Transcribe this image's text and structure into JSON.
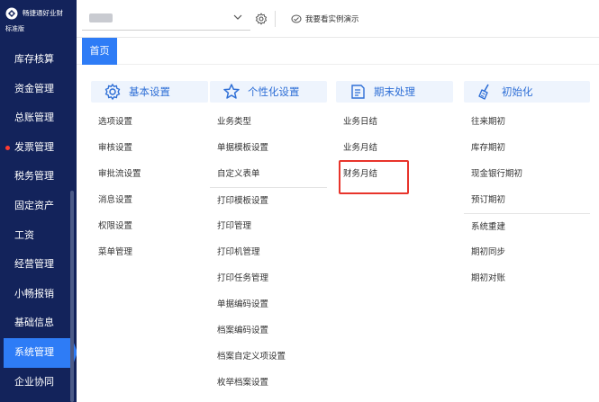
{
  "logo": {
    "brand": "畅捷通好业财",
    "edition": "标准版"
  },
  "sidebar": {
    "items": [
      {
        "label": "库存核算",
        "dot": false,
        "active": false
      },
      {
        "label": "资金管理",
        "dot": false,
        "active": false
      },
      {
        "label": "总账管理",
        "dot": false,
        "active": false
      },
      {
        "label": "发票管理",
        "dot": true,
        "active": false
      },
      {
        "label": "税务管理",
        "dot": false,
        "active": false
      },
      {
        "label": "固定资产",
        "dot": false,
        "active": false
      },
      {
        "label": "工资",
        "dot": false,
        "active": false
      },
      {
        "label": "经营管理",
        "dot": false,
        "active": false
      },
      {
        "label": "小畅报销",
        "dot": false,
        "active": false
      },
      {
        "label": "基础信息",
        "dot": false,
        "active": false
      },
      {
        "label": "系统管理",
        "dot": false,
        "active": true
      },
      {
        "label": "企业协同",
        "dot": false,
        "active": false
      }
    ]
  },
  "topbar": {
    "demo_label": "我要看实例演示"
  },
  "tabs": {
    "home": "首页"
  },
  "menu": {
    "columns": [
      {
        "title": "基本设置",
        "icon": "gear-icon",
        "items": [
          "选项设置",
          "审核设置",
          "审批流设置",
          "消息设置",
          "权限设置",
          "菜单管理"
        ]
      },
      {
        "title": "个性化设置",
        "icon": "star-icon",
        "items": [
          "业务类型",
          "单据模板设置",
          "自定义表单",
          "打印模板设置",
          "打印管理",
          "打印机管理",
          "打印任务管理",
          "单据编码设置",
          "档案编码设置",
          "档案自定义项设置",
          "枚举档案设置"
        ]
      },
      {
        "title": "期末处理",
        "icon": "checklist-icon",
        "items": [
          "业务日结",
          "业务月结",
          "财务月结"
        ]
      },
      {
        "title": "初始化",
        "icon": "broom-icon",
        "items": [
          "往来期初",
          "库存期初",
          "现金银行期初",
          "预订期初",
          "系统重建",
          "期初同步",
          "期初对账"
        ]
      }
    ]
  },
  "colors": {
    "sidebar_bg": "#13235b",
    "accent": "#2e7cf6",
    "highlight": "#e8342b",
    "head_bg": "#eef4fd"
  }
}
